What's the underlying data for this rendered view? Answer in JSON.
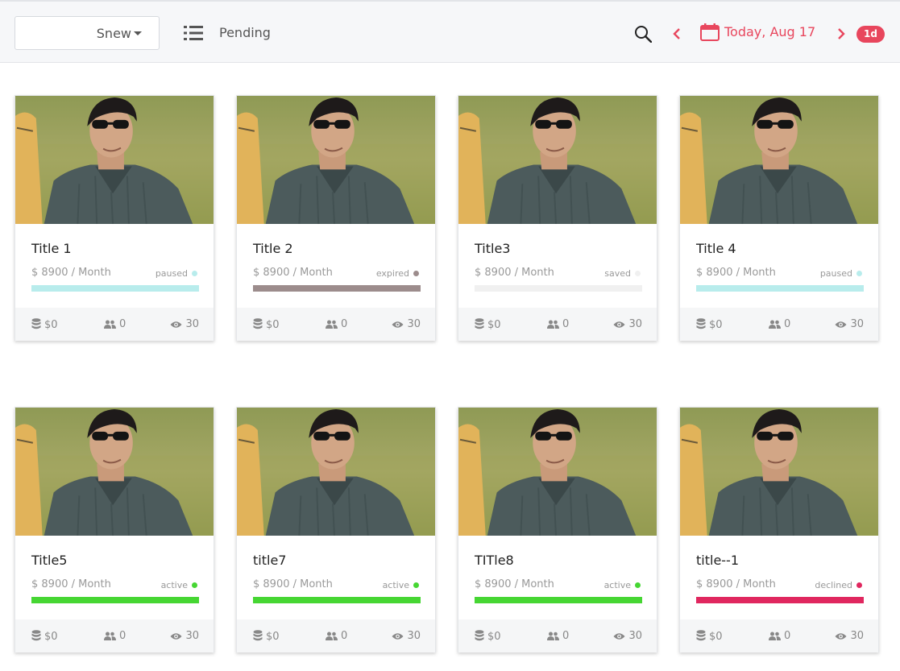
{
  "toolbar": {
    "sort_select_value": "Snew",
    "filter_label": "Pending",
    "date_label": "Today, Aug 17",
    "range_badge": "1d"
  },
  "colors": {
    "accent": "#e8465d",
    "paused": "#b8ecec",
    "expired": "#9c8c8c",
    "saved": "#f0f0f0",
    "active": "#46d633",
    "declined": "#e0275f"
  },
  "cards": [
    {
      "title": "Title 1",
      "price": "$ 8900 / Month",
      "status": "paused",
      "status_color": "#b8ecec",
      "revenue": "$0",
      "people": "0",
      "views": "30"
    },
    {
      "title": "Title 2",
      "price": "$ 8900 / Month",
      "status": "expired",
      "status_color": "#9c8c8c",
      "revenue": "$0",
      "people": "0",
      "views": "30"
    },
    {
      "title": "Title3",
      "price": "$ 8900 / Month",
      "status": "saved",
      "status_color": "#f0f0f0",
      "revenue": "$0",
      "people": "0",
      "views": "30"
    },
    {
      "title": "Title 4",
      "price": "$ 8900 / Month",
      "status": "paused",
      "status_color": "#b8ecec",
      "revenue": "$0",
      "people": "0",
      "views": "30"
    },
    {
      "title": "Title5",
      "price": "$ 8900 / Month",
      "status": "active",
      "status_color": "#46d633",
      "revenue": "$0",
      "people": "0",
      "views": "30"
    },
    {
      "title": "title7",
      "price": "$ 8900 / Month",
      "status": "active",
      "status_color": "#46d633",
      "revenue": "$0",
      "people": "0",
      "views": "30"
    },
    {
      "title": "TITle8",
      "price": "$ 8900 / Month",
      "status": "active",
      "status_color": "#46d633",
      "revenue": "$0",
      "people": "0",
      "views": "30"
    },
    {
      "title": "title--1",
      "price": "$ 8900 / Month",
      "status": "declined",
      "status_color": "#e0275f",
      "revenue": "$0",
      "people": "0",
      "views": "30"
    }
  ]
}
